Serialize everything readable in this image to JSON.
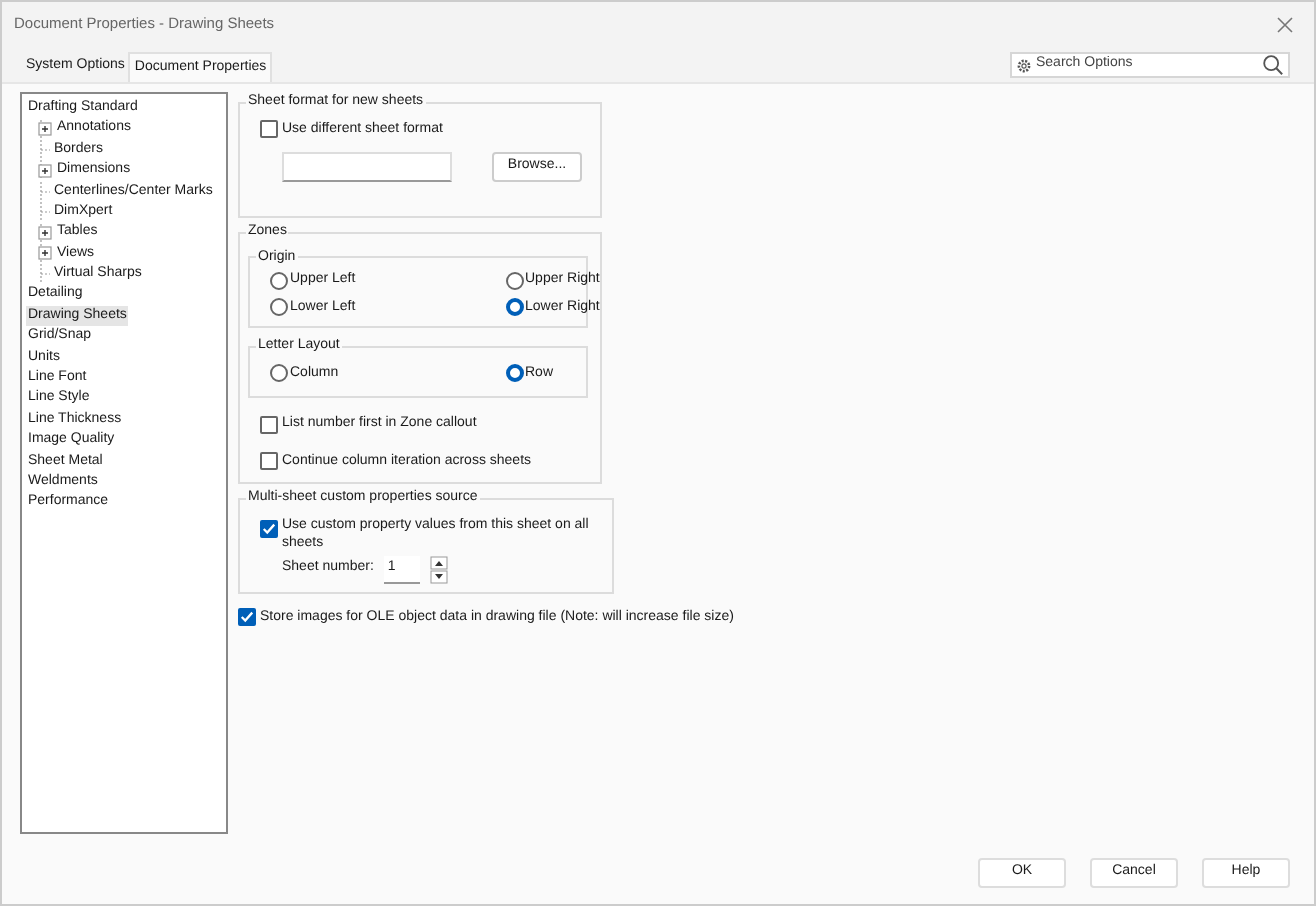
{
  "window": {
    "title": "Document Properties - Drawing Sheets"
  },
  "tabs": [
    {
      "label": "System Options",
      "selected": false
    },
    {
      "label": "Document Properties",
      "selected": true
    }
  ],
  "search": {
    "placeholder": "Search Options"
  },
  "tree": [
    {
      "label": "Drafting Standard",
      "selected": false,
      "children": [
        {
          "label": "Annotations",
          "expanded": false,
          "selected": false
        },
        {
          "label": "Borders",
          "selected": false
        },
        {
          "label": "Dimensions",
          "expanded": false,
          "selected": false
        },
        {
          "label": "Centerlines/Center Marks",
          "selected": false
        },
        {
          "label": "DimXpert",
          "selected": false
        },
        {
          "label": "Tables",
          "expanded": false,
          "selected": false
        },
        {
          "label": "Views",
          "expanded": false,
          "selected": false
        },
        {
          "label": "Virtual Sharps",
          "selected": false
        }
      ]
    },
    {
      "label": "Detailing",
      "selected": false
    },
    {
      "label": "Drawing Sheets",
      "selected": true
    },
    {
      "label": "Grid/Snap",
      "selected": false
    },
    {
      "label": "Units",
      "selected": false
    },
    {
      "label": "Line Font",
      "selected": false
    },
    {
      "label": "Line Style",
      "selected": false
    },
    {
      "label": "Line Thickness",
      "selected": false
    },
    {
      "label": "Image Quality",
      "selected": false
    },
    {
      "label": "Sheet Metal",
      "selected": false
    },
    {
      "label": "Weldments",
      "selected": false
    },
    {
      "label": "Performance",
      "selected": false
    }
  ],
  "sheet_format": {
    "title": "Sheet format for new sheets",
    "use_different": {
      "label": "Use different sheet format",
      "checked": false
    },
    "browse_button": "Browse..."
  },
  "zones": {
    "title": "Zones",
    "origin": {
      "title": "Origin",
      "options": [
        {
          "label": "Upper Left",
          "selected": false
        },
        {
          "label": "Upper Right",
          "selected": false
        },
        {
          "label": "Lower Left",
          "selected": false
        },
        {
          "label": "Lower Right",
          "selected": true
        }
      ]
    },
    "letter_layout": {
      "title": "Letter Layout",
      "options": [
        {
          "label": "Column",
          "selected": false
        },
        {
          "label": "Row",
          "selected": true
        }
      ]
    },
    "checkboxes": [
      {
        "label": "List number first in Zone callout",
        "checked": false
      },
      {
        "label": "Continue column iteration across sheets",
        "checked": false
      }
    ]
  },
  "multi_sheet": {
    "title": "Multi-sheet custom properties source",
    "use_custom": {
      "label": "Use custom property values from this sheet on all sheets",
      "checked": true
    },
    "sheet_number_label": "Sheet number:",
    "sheet_number": "1"
  },
  "store_images": {
    "label": "Store images for OLE object data in drawing file (Note: will increase file size)",
    "checked": true
  },
  "buttons": [
    "OK",
    "Cancel",
    "Help"
  ]
}
